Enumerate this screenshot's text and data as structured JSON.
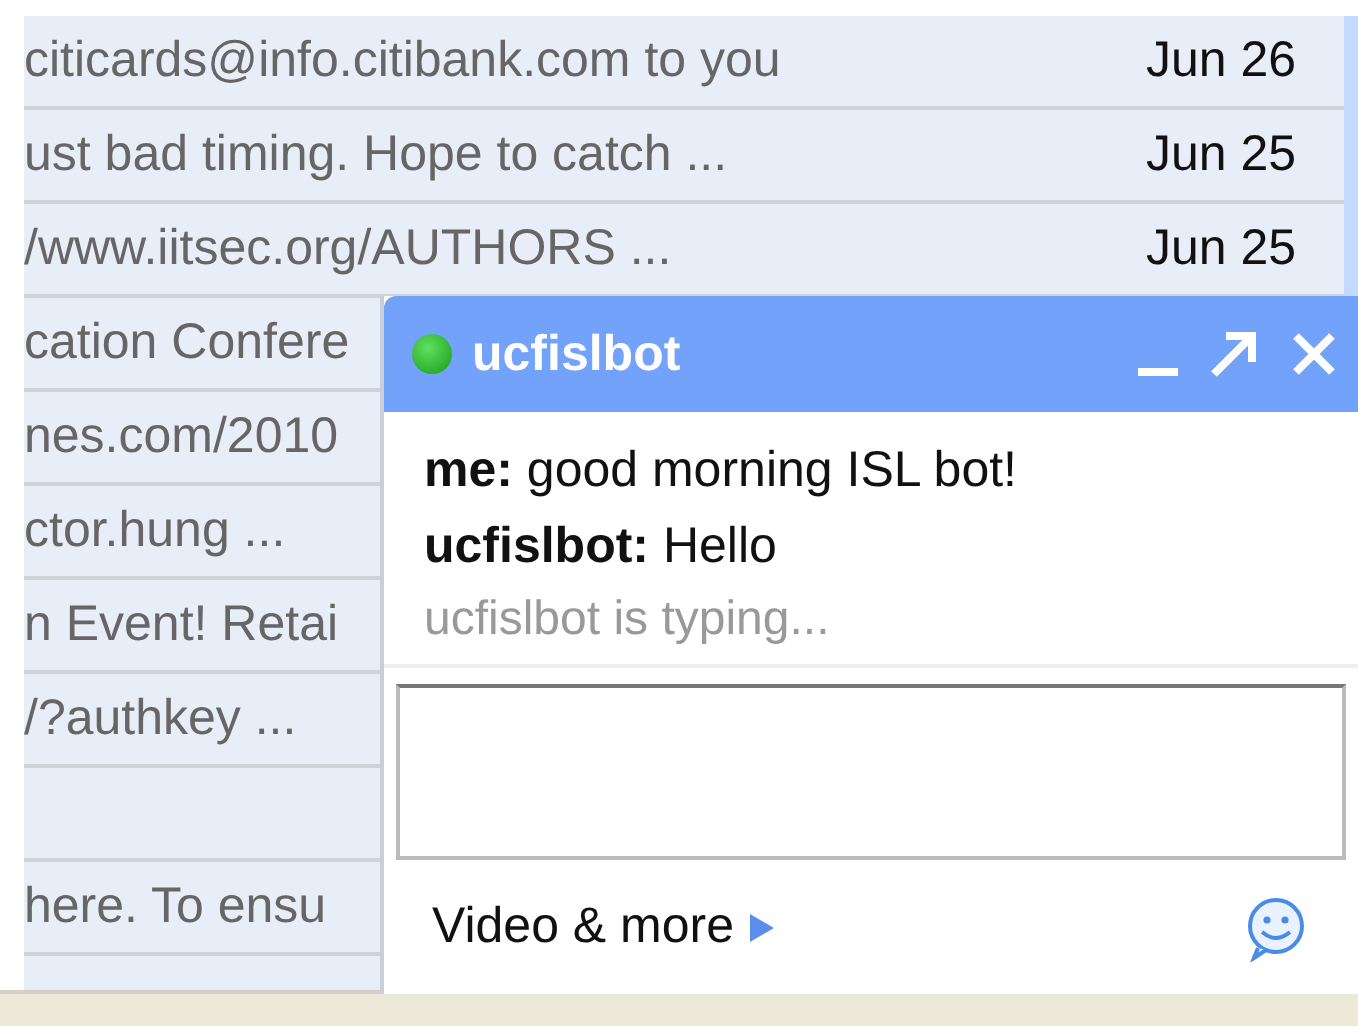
{
  "mail_list": {
    "rows": [
      {
        "snippet": "citicards@info.citibank.com to you",
        "date": "Jun 26"
      },
      {
        "snippet": "ust bad timing. Hope to catch ...",
        "date": "Jun 25"
      },
      {
        "snippet": "/www.iitsec.org/AUTHORS ...",
        "date": "Jun 25"
      },
      {
        "snippet": "cation Confere"
      },
      {
        "snippet": "nes.com/2010"
      },
      {
        "snippet": "ctor.hung ..."
      },
      {
        "snippet": "n Event! Retai"
      },
      {
        "snippet": "/?authkey ..."
      },
      {},
      {
        "snippet": "here. To ensu"
      }
    ]
  },
  "chat_window": {
    "title": "ucfislbot",
    "online": true,
    "messages": [
      {
        "sender": "me:",
        "text": "good morning ISL bot!"
      },
      {
        "sender": "ucfislbot:",
        "text": "Hello"
      }
    ],
    "typing_notice": "ucfislbot is typing...",
    "footer_link": "Video & more"
  }
}
